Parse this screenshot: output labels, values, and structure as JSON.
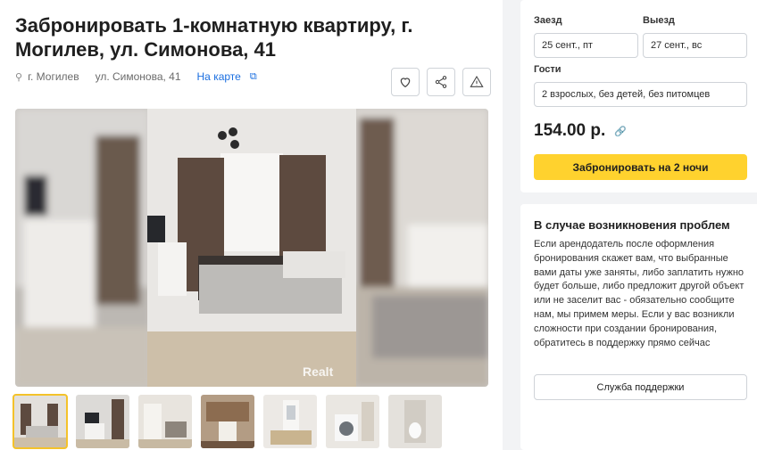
{
  "listing": {
    "title": "Забронировать 1-комнатную квартиру, г. Могилев, ул. Симонова, 41",
    "city": "г. Могилев",
    "street": "ул. Симонова, 41",
    "map_link": "На карте",
    "watermark": "Realt"
  },
  "actions": {
    "favorite": "heart-icon",
    "share": "share-icon",
    "report": "warning-icon"
  },
  "booking": {
    "checkin_label": "Заезд",
    "checkin_value": "25 сент., пт",
    "checkout_label": "Выезд",
    "checkout_value": "27 сент., вс",
    "guests_label": "Гости",
    "guests_value": "2 взрослых, без детей, без питомцев",
    "price": "154.00 р.",
    "book_button": "Забронировать на 2 ночи"
  },
  "problems": {
    "title": "В случае возникновения проблем",
    "text": "Если арендодатель после оформления бронирования скажет вам, что выбранные вами даты уже заняты, либо заплатить нужно будет больше, либо предложит другой объект или не заселит вас - обязательно сообщите нам, мы примем меры. Если у вас возникли сложности при создании бронирования, обратитесь в поддержку прямо сейчас",
    "support_button": "Служба поддержки"
  },
  "colors": {
    "accent": "#ffd22e",
    "link": "#1b6fe0",
    "sidebar_bg": "#f2f3f5"
  }
}
